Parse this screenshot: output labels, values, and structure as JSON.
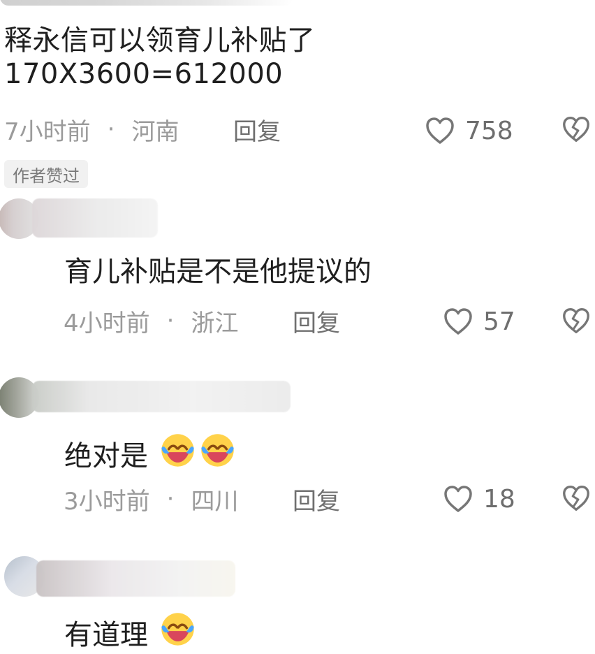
{
  "colors": {
    "meta_text": "#9b9b9b",
    "reply_text": "#6f6f6f",
    "icon_gray": "#767676",
    "badge_bg": "#f1f1f1",
    "badge_text": "#7a7a7a"
  },
  "top_comment": {
    "text_line_1": "释永信可以领育儿补贴了",
    "text_line_2": "170X3600=612000",
    "time": "7小时前",
    "location": "河南",
    "reply_label": "回复",
    "like_count": "758",
    "badge": "作者赞过"
  },
  "replies": [
    {
      "text": "育儿补贴是不是他提议的",
      "time": "4小时前",
      "location": "浙江",
      "reply_label": "回复",
      "like_count": "57"
    },
    {
      "text": "绝对是",
      "emoji_icon": "laughing-crying-emoji-icon",
      "time": "3小时前",
      "location": "四川",
      "reply_label": "回复",
      "like_count": "18"
    },
    {
      "text": "有道理",
      "emoji_icon": "laughing-crying-emoji-icon"
    }
  ],
  "dot_separator": "·"
}
